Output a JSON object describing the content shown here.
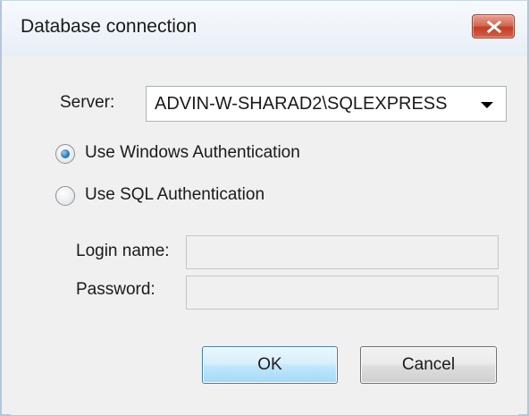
{
  "window": {
    "title": "Database connection",
    "close_icon": "close-icon",
    "close_color": "#c94a2f"
  },
  "form": {
    "server_label": "Server:",
    "server_value": "ADVIN-W-SHARAD2\\SQLEXPRESS",
    "auth_options": [
      {
        "label": "Use Windows Authentication",
        "selected": true
      },
      {
        "label": "Use SQL Authentication",
        "selected": false
      }
    ],
    "login_label": "Login name:",
    "login_value": "",
    "password_label": "Password:",
    "password_value": ""
  },
  "buttons": {
    "ok_label": "OK",
    "cancel_label": "Cancel"
  }
}
